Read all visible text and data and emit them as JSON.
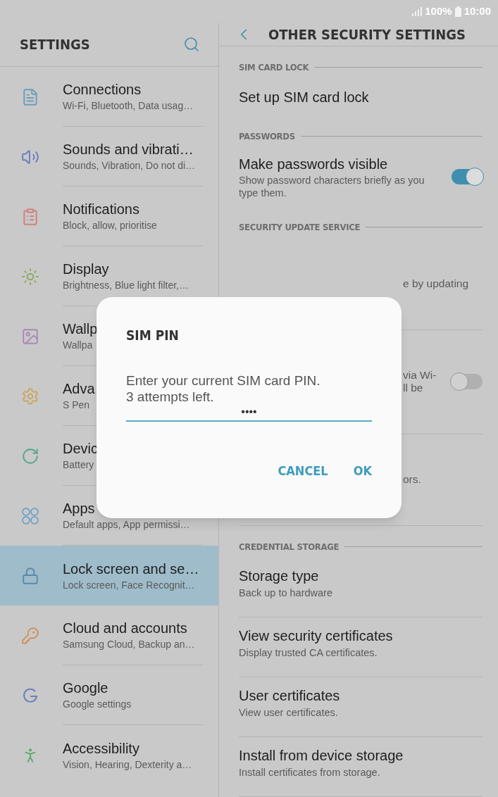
{
  "status_bar": {
    "battery": "100%",
    "time": "10:00"
  },
  "left_panel": {
    "title": "SETTINGS",
    "items": [
      {
        "title": "Connections",
        "subtitle": "Wi-Fi, Bluetooth, Data usag…",
        "selected": false,
        "color": "#6a9fb8"
      },
      {
        "title": "Sounds and vibrati…",
        "subtitle": "Sounds, Vibration, Do not di…",
        "selected": false,
        "color": "#6c7fc0"
      },
      {
        "title": "Notifications",
        "subtitle": "Block, allow, prioritise",
        "selected": false,
        "color": "#d08080"
      },
      {
        "title": "Display",
        "subtitle": "Brightness, Blue light filter,…",
        "selected": false,
        "color": "#8aa860"
      },
      {
        "title": "Wallp",
        "subtitle": "Wallpa",
        "selected": false,
        "color": "#a98ab8"
      },
      {
        "title": "Adva",
        "subtitle": "S Pen",
        "selected": false,
        "color": "#c8a860"
      },
      {
        "title": "Devic",
        "subtitle": "Battery",
        "selected": false,
        "color": "#5aa88a"
      },
      {
        "title": "Apps",
        "subtitle": "Default apps, App permissi…",
        "selected": false,
        "color": "#5a9ac8"
      },
      {
        "title": "Lock screen and se…",
        "subtitle": "Lock screen, Face Recognit…",
        "selected": true,
        "color": "#5a8aa8"
      },
      {
        "title": "Cloud and accounts",
        "subtitle": "Samsung Cloud, Backup an…",
        "selected": false,
        "color": "#d0905a"
      },
      {
        "title": "Google",
        "subtitle": "Google settings",
        "selected": false,
        "color": "#6a80c0"
      },
      {
        "title": "Accessibility",
        "subtitle": "Vision, Hearing, Dexterity a…",
        "selected": false,
        "color": "#5aa870"
      }
    ]
  },
  "right_panel": {
    "title": "OTHER SECURITY SETTINGS",
    "items": [
      {
        "kind": "header",
        "title": "SIM CARD LOCK"
      },
      {
        "kind": "item",
        "title": "Set up SIM card lock"
      },
      {
        "kind": "header",
        "title": "PASSWORDS"
      },
      {
        "kind": "toggle",
        "title": "Make passwords visible",
        "subtitle": "Show password characters briefly as you type them.",
        "on": true
      },
      {
        "kind": "header",
        "title": "SECURITY UPDATE SERVICE"
      },
      {
        "kind": "partial",
        "lines": [
          "e by updating"
        ]
      },
      {
        "kind": "partial_toggle",
        "lines": [
          "via Wi-",
          "ll be"
        ],
        "on": false
      },
      {
        "kind": "partial",
        "lines": [
          "ors."
        ]
      },
      {
        "kind": "header",
        "title": "CREDENTIAL STORAGE"
      },
      {
        "kind": "item",
        "title": "Storage type",
        "subtitle": "Back up to hardware"
      },
      {
        "kind": "item",
        "title": "View security certificates",
        "subtitle": "Display trusted CA certificates."
      },
      {
        "kind": "item",
        "title": "User certificates",
        "subtitle": "View user certificates."
      },
      {
        "kind": "item",
        "title": "Install from device storage",
        "subtitle": "Install certificates from storage."
      }
    ]
  },
  "dialog": {
    "title": "SIM PIN",
    "message": [
      "Enter your current SIM card PIN.",
      "3 attempts left."
    ],
    "field": {
      "value": "••••"
    },
    "buttons": [
      "CANCEL",
      "OK"
    ]
  }
}
